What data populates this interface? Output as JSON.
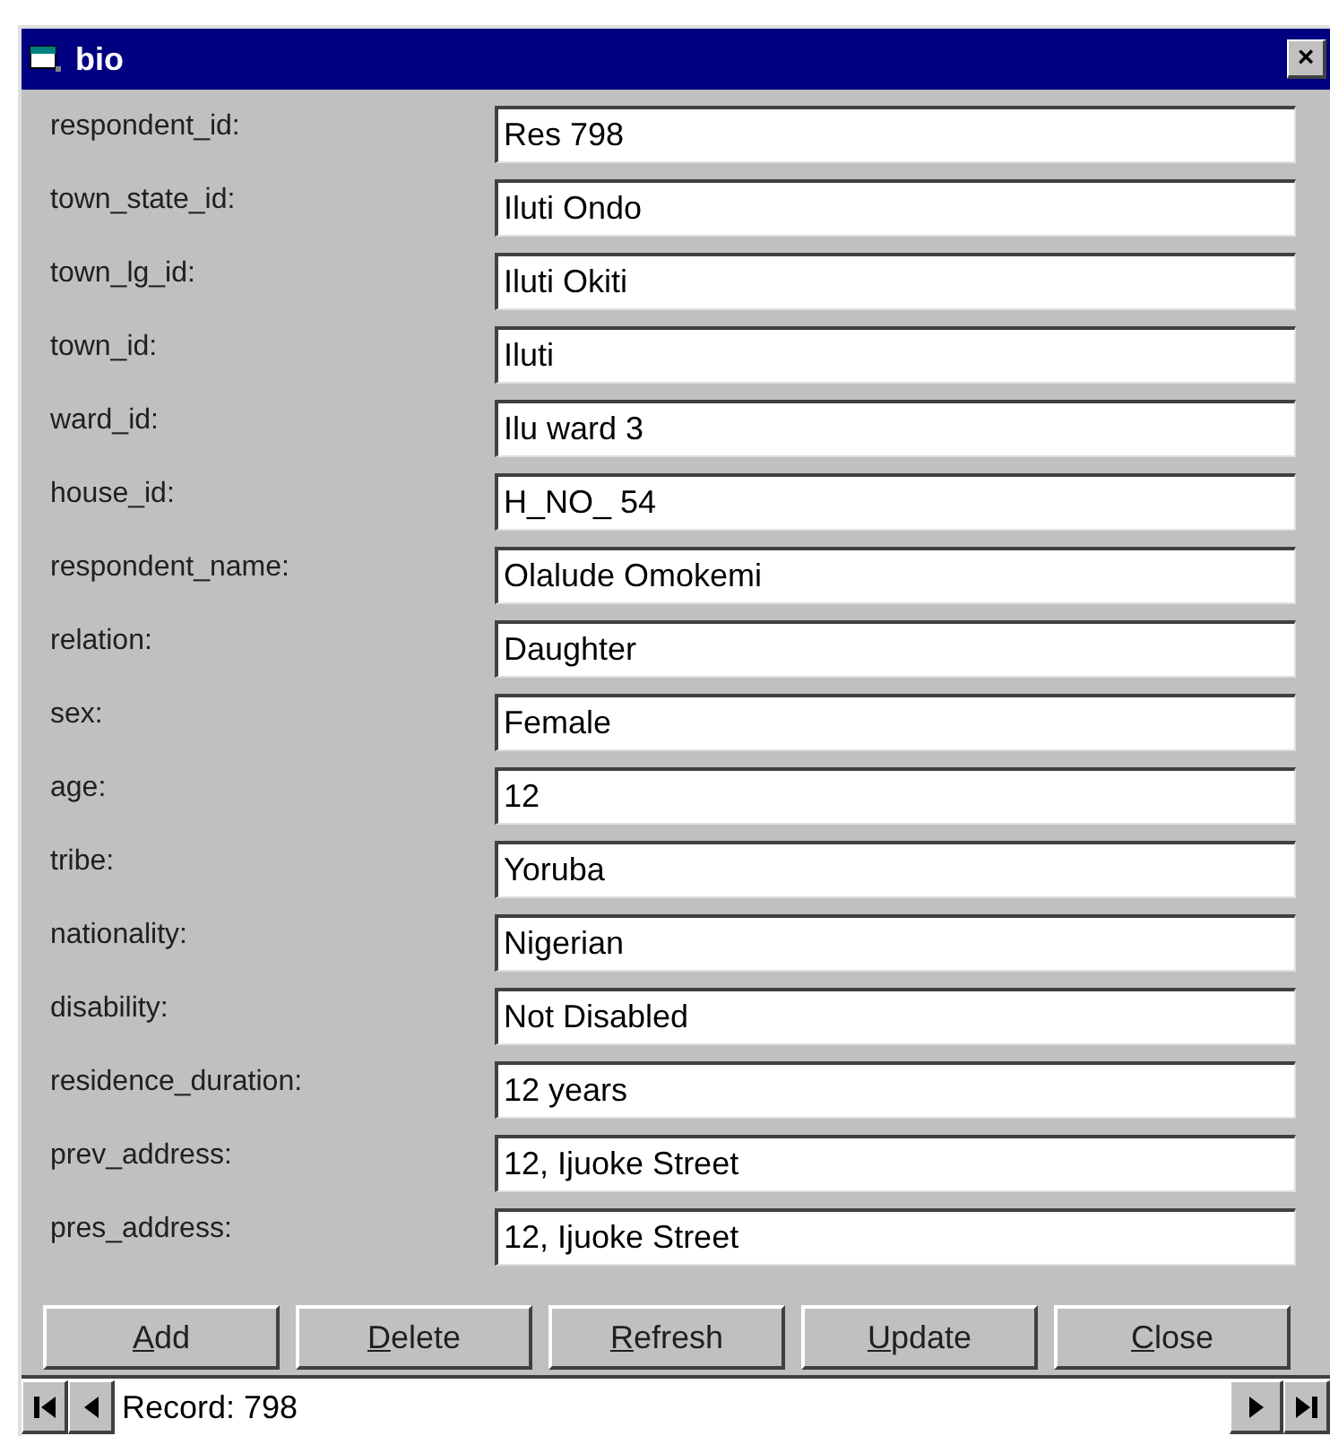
{
  "window": {
    "title": "bio",
    "close": "×"
  },
  "fields": [
    {
      "label": "respondent_id:",
      "value": "Res 798"
    },
    {
      "label": "town_state_id:",
      "value": "Iluti Ondo"
    },
    {
      "label": "town_lg_id:",
      "value": "Iluti Okiti"
    },
    {
      "label": "town_id:",
      "value": "Iluti"
    },
    {
      "label": "ward_id:",
      "value": "Ilu ward 3"
    },
    {
      "label": "house_id:",
      "value": "H_NO_ 54"
    },
    {
      "label": "respondent_name:",
      "value": "Olalude Omokemi"
    },
    {
      "label": "relation:",
      "value": "Daughter"
    },
    {
      "label": "sex:",
      "value": "Female"
    },
    {
      "label": "age:",
      "value": "12"
    },
    {
      "label": "tribe:",
      "value": "Yoruba"
    },
    {
      "label": "nationality:",
      "value": "Nigerian"
    },
    {
      "label": "disability:",
      "value": "Not Disabled"
    },
    {
      "label": "residence_duration:",
      "value": "12 years"
    },
    {
      "label": "prev_address:",
      "value": "12, Ijuoke Street"
    },
    {
      "label": "pres_address:",
      "value": "12, Ijuoke Street"
    }
  ],
  "buttons": [
    "Add",
    "Delete",
    "Refresh",
    "Update",
    "Close"
  ],
  "navigator": {
    "record": "Record: 798"
  }
}
